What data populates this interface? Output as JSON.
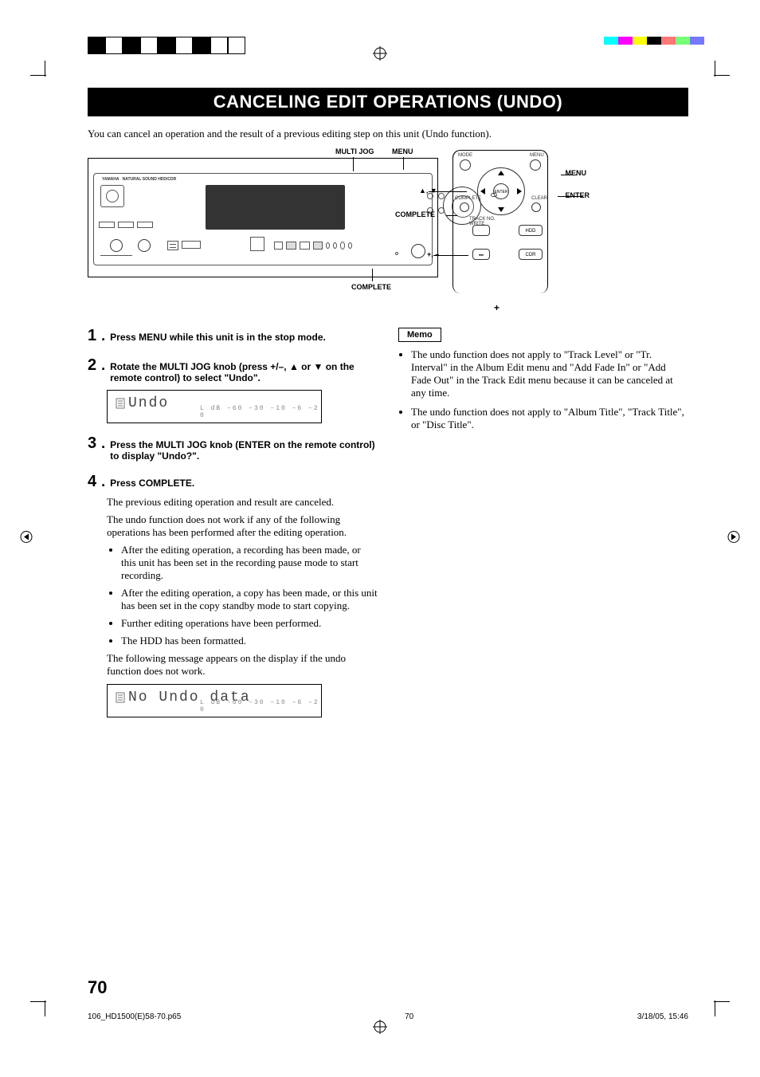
{
  "header": {
    "title": "CANCELING EDIT OPERATIONS (UNDO)",
    "intro": "You can cancel an operation and the result of a previous editing step on this unit (Undo function)."
  },
  "diagram": {
    "unit_labels": {
      "multi_jog": "MULTI JOG",
      "menu": "MENU",
      "complete": "COMPLETE"
    },
    "remote": {
      "mode": "MODE",
      "menu_tiny": "MENU",
      "enter_tiny": "ENTER",
      "complete_tiny": "COMPLETE",
      "clear_tiny": "CLEAR",
      "track_no_write": "TRACK NO.\nWRITE",
      "hdd": "HDD",
      "cdr": "CDR",
      "callouts": {
        "menu": "MENU",
        "enter": "ENTER",
        "updown": "▲, ▼",
        "complete": "COMPLETE",
        "plusminus": "+, –"
      }
    }
  },
  "steps": [
    {
      "num": "1",
      "title": "Press MENU while this unit is in the stop mode."
    },
    {
      "num": "2",
      "title": "Rotate the MULTI JOG knob (press +/–, ▲ or ▼ on the remote control) to select \"Undo\".",
      "display": {
        "main": "Undo",
        "sub": "L   dB  –60      –30    –10   –6   –2     0"
      }
    },
    {
      "num": "3",
      "title": "Press the MULTI JOG knob (ENTER on the remote control) to display \"Undo?\"."
    },
    {
      "num": "4",
      "title": "Press COMPLETE.",
      "body_paragraphs": [
        "The previous editing operation and result are canceled.",
        "The undo function does not work if any of the following operations has been performed after the editing operation."
      ],
      "bullets": [
        "After the editing operation, a recording has been made, or this unit has been set in the recording pause mode to start recording.",
        "After the editing operation, a copy has been made, or this unit has been set in the copy standby mode to start copying.",
        "Further editing operations have been performed.",
        "The HDD has been formatted."
      ],
      "after": "The following message appears on the display if the undo function does not work.",
      "display2": {
        "main": "No Undo data",
        "sub": "L   dB  –60      –30    –10   –6   –2     0"
      }
    }
  ],
  "memo": {
    "label": "Memo",
    "items": [
      "The undo function does not apply to \"Track Level\" or \"Tr. Interval\" in the Album Edit menu and \"Add Fade In\" or \"Add Fade Out\" in the Track Edit menu because it can be canceled at any time.",
      "The undo function does not apply to \"Album Title\", \"Track Title\", or \"Disc Title\"."
    ]
  },
  "page_number": "70",
  "footer": {
    "left": "106_HD1500(E)58-70.p65",
    "center": "70",
    "right": "3/18/05, 15:46"
  }
}
